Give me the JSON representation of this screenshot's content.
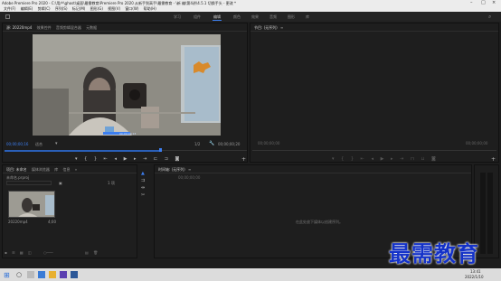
{
  "titlebar": {
    "title": "Adobe Premiere Pro 2020 - C:\\用户\\ghost\\桌面\\最需教育\\Premiere Pro 2020 从新手到高手\\最需教育 - \\新 编\\第4讲\\4.5.1 切换手头 - 更改 *"
  },
  "menubar": [
    "文件(F)",
    "编辑(E)",
    "剪辑(C)",
    "序列(S)",
    "标记(M)",
    "图形(G)",
    "视图(V)",
    "窗口(W)",
    "帮助(H)"
  ],
  "workspaces": [
    "学习",
    "组件",
    "编辑",
    "颜色",
    "效果",
    "音频",
    "图形",
    "库"
  ],
  "source": {
    "tabs": [
      "源: 20220mp4",
      "效果控件",
      "音频剪辑混合器",
      "元数据"
    ],
    "timecode_in": "00;00;00;16",
    "fit": "适合",
    "ratio": "1/2",
    "timecode_dur": "00;00;00;20",
    "clip_tc": "00;00;00;13"
  },
  "program": {
    "tabs": [
      "节目: (无序列)"
    ],
    "timecode_in": "00;00;00;00",
    "timecode_dur": "00;00;00;00"
  },
  "project": {
    "tabs": [
      "项目: 未命名",
      "媒体浏览器",
      "库",
      "信息"
    ],
    "path": "未命名.prproj",
    "count": "1 项",
    "clip_name": "20220mp4",
    "clip_dur": "4;00"
  },
  "timeline": {
    "tab": "时间轴: (无序列)",
    "timecode": "00;00;00;00",
    "empty_message": "在此处放下媒体以创建序列。"
  },
  "taskbar": {
    "time": "13:41",
    "date": "2022/1/10"
  },
  "watermark": "最需教育",
  "colors": {
    "accent": "#3c7ef0",
    "playhead": "#3c7ef0",
    "watermark": "#1432c8"
  }
}
